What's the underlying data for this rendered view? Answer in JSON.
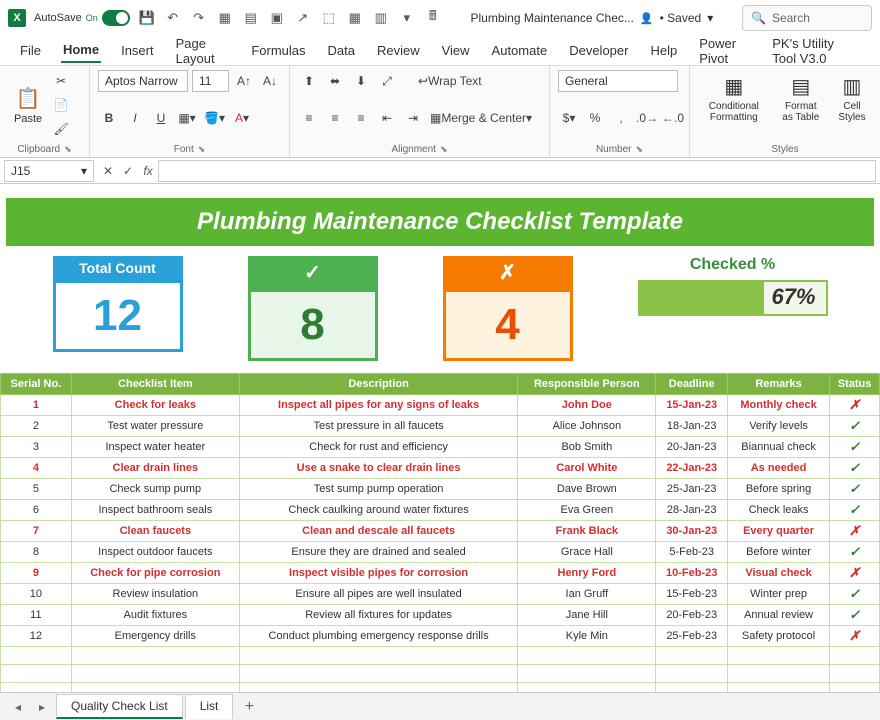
{
  "titlebar": {
    "autosave": "AutoSave",
    "autosave_state": "On",
    "doc_name": "Plumbing Maintenance Chec...",
    "saved": "• Saved",
    "search_placeholder": "Search"
  },
  "tabs": [
    "File",
    "Home",
    "Insert",
    "Page Layout",
    "Formulas",
    "Data",
    "Review",
    "View",
    "Automate",
    "Developer",
    "Help",
    "Power Pivot",
    "PK's Utility Tool V3.0"
  ],
  "ribbon": {
    "clipboard": {
      "paste": "Paste",
      "label": "Clipboard"
    },
    "font": {
      "name": "Aptos Narrow",
      "size": "11",
      "label": "Font"
    },
    "alignment": {
      "wrap": "Wrap Text",
      "merge": "Merge & Center",
      "label": "Alignment"
    },
    "number": {
      "format": "General",
      "label": "Number"
    },
    "styles": {
      "cond": "Conditional Formatting",
      "table": "Format as Table",
      "cell": "Cell Styles",
      "label": "Styles"
    }
  },
  "namebox": "J15",
  "banner": "Plumbing Maintenance Checklist Template",
  "cards": {
    "total_label": "Total Count",
    "total_value": "12",
    "ok_label": "✓",
    "ok_value": "8",
    "no_label": "✗",
    "no_value": "4",
    "checked_label": "Checked %",
    "checked_value": "67%",
    "checked_pct": 67
  },
  "headers": [
    "Serial No.",
    "Checklist Item",
    "Description",
    "Responsible Person",
    "Deadline",
    "Remarks",
    "Status"
  ],
  "rows": [
    {
      "n": "1",
      "item": "Check for leaks",
      "desc": "Inspect all pipes for any signs of leaks",
      "who": "John Doe",
      "due": "15-Jan-23",
      "rem": "Monthly check",
      "ok": false,
      "emp": true
    },
    {
      "n": "2",
      "item": "Test water pressure",
      "desc": "Test pressure in all faucets",
      "who": "Alice Johnson",
      "due": "18-Jan-23",
      "rem": "Verify levels",
      "ok": true,
      "emp": false
    },
    {
      "n": "3",
      "item": "Inspect water heater",
      "desc": "Check for rust and efficiency",
      "who": "Bob Smith",
      "due": "20-Jan-23",
      "rem": "Biannual check",
      "ok": true,
      "emp": false
    },
    {
      "n": "4",
      "item": "Clear drain lines",
      "desc": "Use a snake to clear drain lines",
      "who": "Carol White",
      "due": "22-Jan-23",
      "rem": "As needed",
      "ok": true,
      "emp": true
    },
    {
      "n": "5",
      "item": "Check sump pump",
      "desc": "Test sump pump operation",
      "who": "Dave Brown",
      "due": "25-Jan-23",
      "rem": "Before spring",
      "ok": true,
      "emp": false
    },
    {
      "n": "6",
      "item": "Inspect bathroom seals",
      "desc": "Check caulking around water fixtures",
      "who": "Eva Green",
      "due": "28-Jan-23",
      "rem": "Check leaks",
      "ok": true,
      "emp": false
    },
    {
      "n": "7",
      "item": "Clean faucets",
      "desc": "Clean and descale all faucets",
      "who": "Frank Black",
      "due": "30-Jan-23",
      "rem": "Every quarter",
      "ok": false,
      "emp": true
    },
    {
      "n": "8",
      "item": "Inspect outdoor faucets",
      "desc": "Ensure they are drained and sealed",
      "who": "Grace Hall",
      "due": "5-Feb-23",
      "rem": "Before winter",
      "ok": true,
      "emp": false
    },
    {
      "n": "9",
      "item": "Check for pipe corrosion",
      "desc": "Inspect visible pipes for corrosion",
      "who": "Henry Ford",
      "due": "10-Feb-23",
      "rem": "Visual check",
      "ok": false,
      "emp": true
    },
    {
      "n": "10",
      "item": "Review insulation",
      "desc": "Ensure all pipes are well insulated",
      "who": "Ian Gruff",
      "due": "15-Feb-23",
      "rem": "Winter prep",
      "ok": true,
      "emp": false
    },
    {
      "n": "11",
      "item": "Audit fixtures",
      "desc": "Review all fixtures for updates",
      "who": "Jane Hill",
      "due": "20-Feb-23",
      "rem": "Annual review",
      "ok": true,
      "emp": false
    },
    {
      "n": "12",
      "item": "Emergency drills",
      "desc": "Conduct plumbing emergency response drills",
      "who": "Kyle Min",
      "due": "25-Feb-23",
      "rem": "Safety protocol",
      "ok": false,
      "emp": false
    }
  ],
  "sheet_tabs": [
    "Quality Check List",
    "List"
  ],
  "chart_data": {
    "type": "table",
    "title": "Plumbing Maintenance Checklist Template",
    "summary": {
      "total": 12,
      "checked": 8,
      "unchecked": 4,
      "checked_pct": 67
    }
  }
}
